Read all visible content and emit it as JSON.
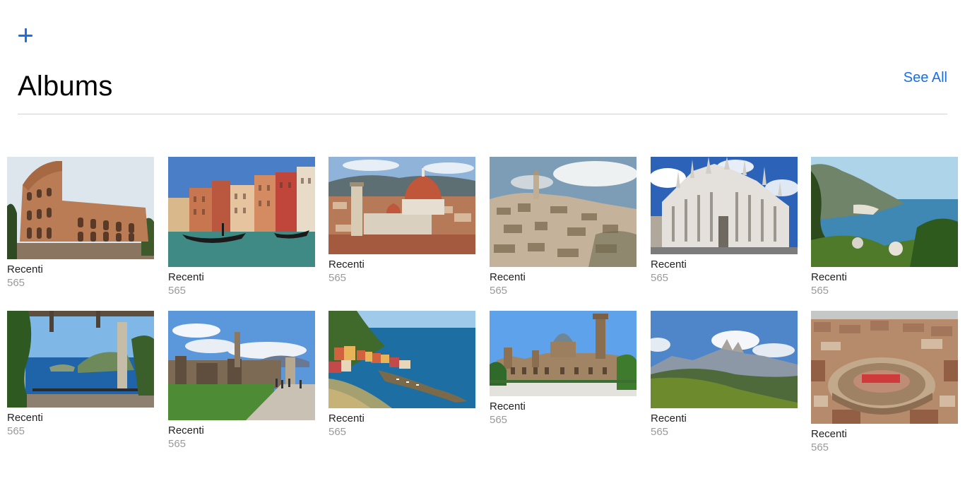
{
  "header": {
    "add_icon": "plus-icon",
    "title": "Albums",
    "see_all_label": "See All",
    "accent_color": "#1a6fe8"
  },
  "albums": [
    {
      "name": "Recenti",
      "count": "565",
      "subject": "colosseum"
    },
    {
      "name": "Recenti",
      "count": "565",
      "subject": "venice-canal"
    },
    {
      "name": "Recenti",
      "count": "565",
      "subject": "florence-duomo"
    },
    {
      "name": "Recenti",
      "count": "565",
      "subject": "matera"
    },
    {
      "name": "Recenti",
      "count": "565",
      "subject": "milan-duomo"
    },
    {
      "name": "Recenti",
      "count": "565",
      "subject": "amalfi-coast"
    },
    {
      "name": "Recenti",
      "count": "565",
      "subject": "capri"
    },
    {
      "name": "Recenti",
      "count": "565",
      "subject": "pompeii"
    },
    {
      "name": "Recenti",
      "count": "565",
      "subject": "vernazza"
    },
    {
      "name": "Recenti",
      "count": "565",
      "subject": "palermo-cathedral"
    },
    {
      "name": "Recenti",
      "count": "565",
      "subject": "dolomites"
    },
    {
      "name": "Recenti",
      "count": "565",
      "subject": "verona-arena"
    }
  ]
}
